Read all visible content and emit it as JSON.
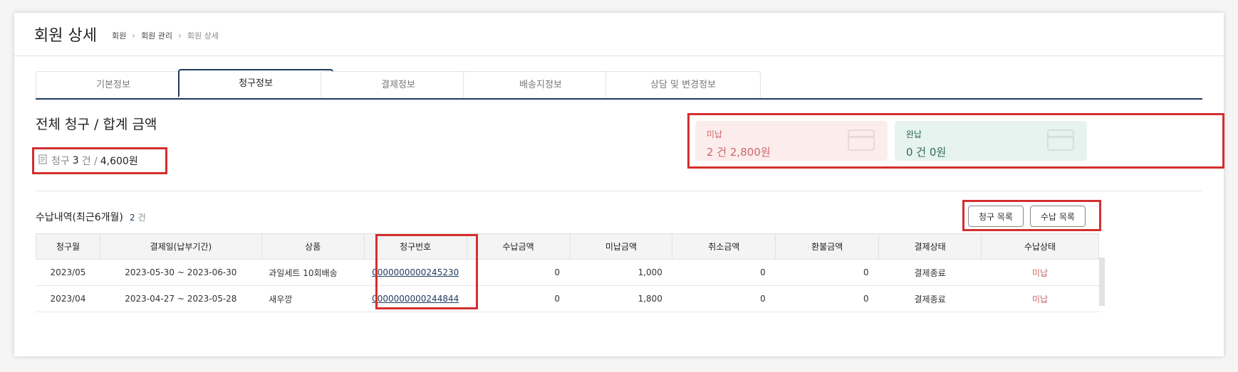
{
  "header": {
    "title": "회원 상세",
    "breadcrumb": [
      "회원",
      "회원 관리",
      "회원 상세"
    ]
  },
  "tabs": [
    {
      "label": "기본정보",
      "active": false
    },
    {
      "label": "청구정보",
      "active": true
    },
    {
      "label": "결제정보",
      "active": false
    },
    {
      "label": "배송지정보",
      "active": false
    },
    {
      "label": "상담 및 변경정보",
      "active": false
    }
  ],
  "billing": {
    "section_title": "전체 청구 / 합계 금액",
    "total": {
      "label": "청구",
      "count": "3",
      "unit": "건 /",
      "amount": "4,600원"
    },
    "unpaid": {
      "label": "미납",
      "value": "2 건 2,800원"
    },
    "paid": {
      "label": "완납",
      "value": "0 건 0원"
    }
  },
  "history": {
    "title": "수납내역(최근6개월)",
    "count": "2",
    "count_unit": "건",
    "buttons": {
      "claim_list": "청구 목록",
      "payment_list": "수납 목록"
    },
    "columns": [
      "청구월",
      "결제일(납부기간)",
      "상품",
      "청구번호",
      "수납금액",
      "미납금액",
      "취소금액",
      "환불금액",
      "결제상태",
      "수납상태"
    ],
    "rows": [
      {
        "month": "2023/05",
        "period": "2023-05-30 ~ 2023-06-30",
        "product": "과일세트 10회배송",
        "claim_no": "0000000000245230",
        "paid": "0",
        "unpaid": "1,000",
        "cancel": "0",
        "refund": "0",
        "pay_status": "결제종료",
        "receipt_status": "미납"
      },
      {
        "month": "2023/04",
        "period": "2023-04-27 ~ 2023-05-28",
        "product": "새우깡",
        "claim_no": "0000000000244844",
        "paid": "0",
        "unpaid": "1,800",
        "cancel": "0",
        "refund": "0",
        "pay_status": "결제종료",
        "receipt_status": "미납"
      }
    ]
  },
  "colors": {
    "accent": "#1e3a5f",
    "highlight": "#d32f2f",
    "unpaid_bg": "#fdecec",
    "paid_bg": "#e6f3ee"
  }
}
